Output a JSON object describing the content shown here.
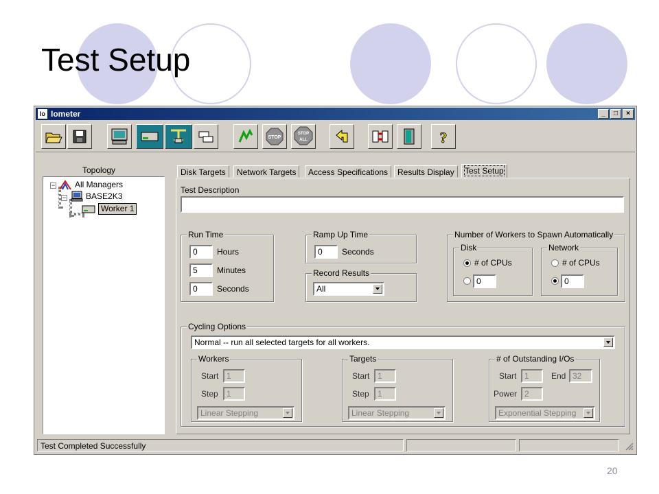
{
  "slide": {
    "title": "Test Setup",
    "page_number": "20"
  },
  "window": {
    "title": "Iometer",
    "app_icon": "Io",
    "controls": [
      "minimize",
      "maximize",
      "close"
    ]
  },
  "toolbar": {
    "buttons": [
      {
        "name": "open-config-button",
        "icon": "folder-open-icon"
      },
      {
        "name": "save-config-button",
        "icon": "floppy-disk-icon"
      },
      {
        "name": "start-display-button",
        "icon": "monitor-icon"
      },
      {
        "name": "new-disk-worker-button",
        "icon": "disk-worker-icon"
      },
      {
        "name": "new-network-worker-button",
        "icon": "network-worker-icon"
      },
      {
        "name": "duplicate-worker-button",
        "icon": "duplicate-icon"
      },
      {
        "name": "start-tests-button",
        "icon": "green-flag-icon"
      },
      {
        "name": "stop-button",
        "icon": "stop-sign-icon",
        "label": "STOP"
      },
      {
        "name": "stop-all-button",
        "icon": "stop-all-icon",
        "label": "STOP ALL"
      },
      {
        "name": "reset-workers-button",
        "icon": "reset-arrow-icon"
      },
      {
        "name": "exit-button",
        "icon": "exit-door-icon"
      },
      {
        "name": "about-button",
        "icon": "question-mark-icon",
        "label": "?"
      }
    ]
  },
  "topology": {
    "title": "Topology",
    "items": [
      {
        "label": "All Managers"
      },
      {
        "label": "BASE2K3"
      },
      {
        "label": "Worker 1"
      }
    ]
  },
  "tabs": [
    {
      "label": "Disk Targets"
    },
    {
      "label": "Network Targets"
    },
    {
      "label": "Access Specifications"
    },
    {
      "label": "Results Display"
    },
    {
      "label": "Test Setup",
      "active": true
    }
  ],
  "test_setup": {
    "description_label": "Test Description",
    "description_value": "",
    "run_time": {
      "title": "Run Time",
      "hours_value": "0",
      "hours_label": "Hours",
      "minutes_value": "5",
      "minutes_label": "Minutes",
      "seconds_value": "0",
      "seconds_label": "Seconds"
    },
    "ramp_up": {
      "title": "Ramp Up Time",
      "value": "0",
      "label": "Seconds"
    },
    "record_results": {
      "title": "Record Results",
      "value": "All"
    },
    "workers_spawn": {
      "title": "Number of Workers to Spawn Automatically",
      "disk": {
        "title": "Disk",
        "option_cpus": "# of CPUs",
        "count": "0",
        "selected": "cpus"
      },
      "network": {
        "title": "Network",
        "option_cpus": "# of CPUs",
        "count": "0",
        "selected": "count"
      }
    },
    "cycling": {
      "title": "Cycling Options",
      "value": "Normal -- run all selected targets for all workers.",
      "workers": {
        "title": "Workers",
        "start_label": "Start",
        "start_value": "1",
        "step_label": "Step",
        "step_value": "1",
        "stepping": "Linear Stepping"
      },
      "targets": {
        "title": "Targets",
        "start_label": "Start",
        "start_value": "1",
        "step_label": "Step",
        "step_value": "1",
        "stepping": "Linear Stepping"
      },
      "outstanding": {
        "title": "# of Outstanding I/Os",
        "start_label": "Start",
        "start_value": "1",
        "end_label": "End",
        "end_value": "32",
        "power_label": "Power",
        "power_value": "2",
        "stepping": "Exponential Stepping"
      }
    }
  },
  "status_bar": {
    "text": "Test Completed Successfully"
  }
}
